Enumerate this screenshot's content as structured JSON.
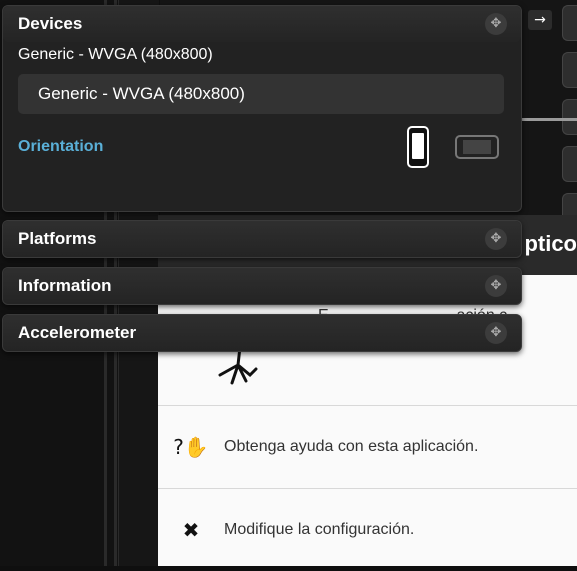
{
  "devices_panel": {
    "title": "Devices",
    "current_device": "Generic - WVGA (480x800)",
    "selected_device": "Generic - WVGA (480x800)",
    "orientation_label": "Orientation"
  },
  "platforms_panel": {
    "title": "Platforms"
  },
  "information_panel": {
    "title": "Information"
  },
  "accelerometer_panel": {
    "title": "Accelerometer"
  },
  "app": {
    "title_fragment": "ptico",
    "description_fragment_1": "E...",
    "description_fragment_2": "ación c",
    "help_row": {
      "icon": "help-icon",
      "label": "Obtenga ayuda con esta aplicación."
    },
    "settings_row": {
      "icon": "tools-icon",
      "label": "Modifique la configuración."
    }
  },
  "colors": {
    "panel_bg": "#222222",
    "orientation_accent": "#5ab0d8",
    "app_bg": "#fafafa"
  }
}
